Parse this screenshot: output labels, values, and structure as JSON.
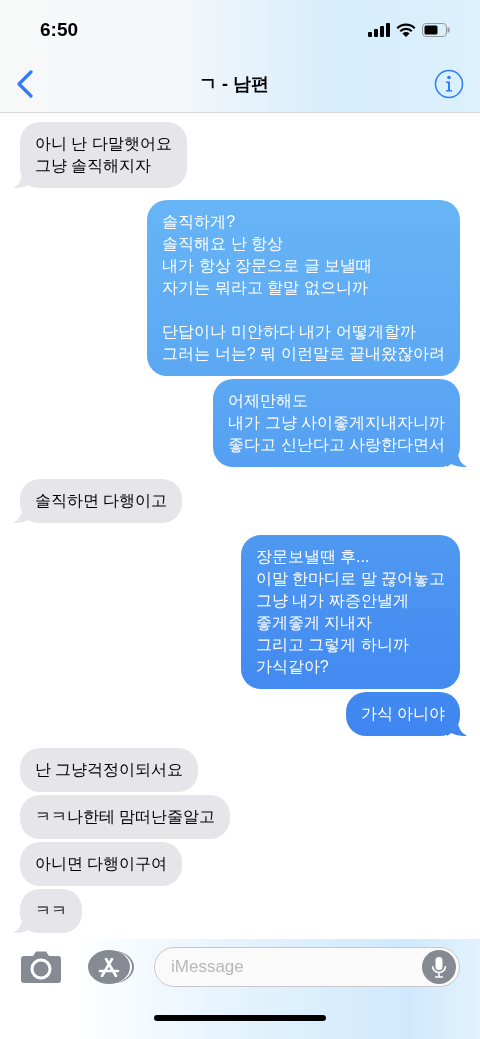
{
  "status_bar": {
    "time": "6:50"
  },
  "nav": {
    "title": "ㄱ - 남편"
  },
  "messages": [
    {
      "kind": "received",
      "text": "아니 난 다말햇어요\n그냥 솔직해지자"
    },
    {
      "kind": "sent",
      "text": "솔직하게?\n솔직해요 난 항상\n내가 항상 장문으로 글 보낼때\n자기는 뭐라고 할말 없으니까\n\n단답이나 미안하다 내가 어떻게할까\n그러는 너는? 뭐 이런말로 끝내왔잖아려"
    },
    {
      "kind": "sent",
      "text": "어제만해도\n내가 그냥 사이좋게지내자니까\n좋다고 신난다고 사랑한다면서"
    },
    {
      "kind": "received",
      "text": "솔직하면 다행이고"
    },
    {
      "kind": "sent",
      "text": "장문보낼땐 후...\n이말 한마디로 말 끊어놓고\n그냥 내가 짜증안낼게\n좋게좋게 지내자\n그리고 그렇게 하니까\n가식같아?"
    },
    {
      "kind": "sent",
      "text": "가식 아니야"
    },
    {
      "kind": "received",
      "text": "난 그냥걱정이되서요"
    },
    {
      "kind": "received",
      "text": "ㅋㅋ나한테 맘떠난줄알고"
    },
    {
      "kind": "received",
      "text": "아니면 다행이구여"
    },
    {
      "kind": "received",
      "text": "ㅋㅋ"
    }
  ],
  "composer": {
    "placeholder": "iMessage"
  }
}
